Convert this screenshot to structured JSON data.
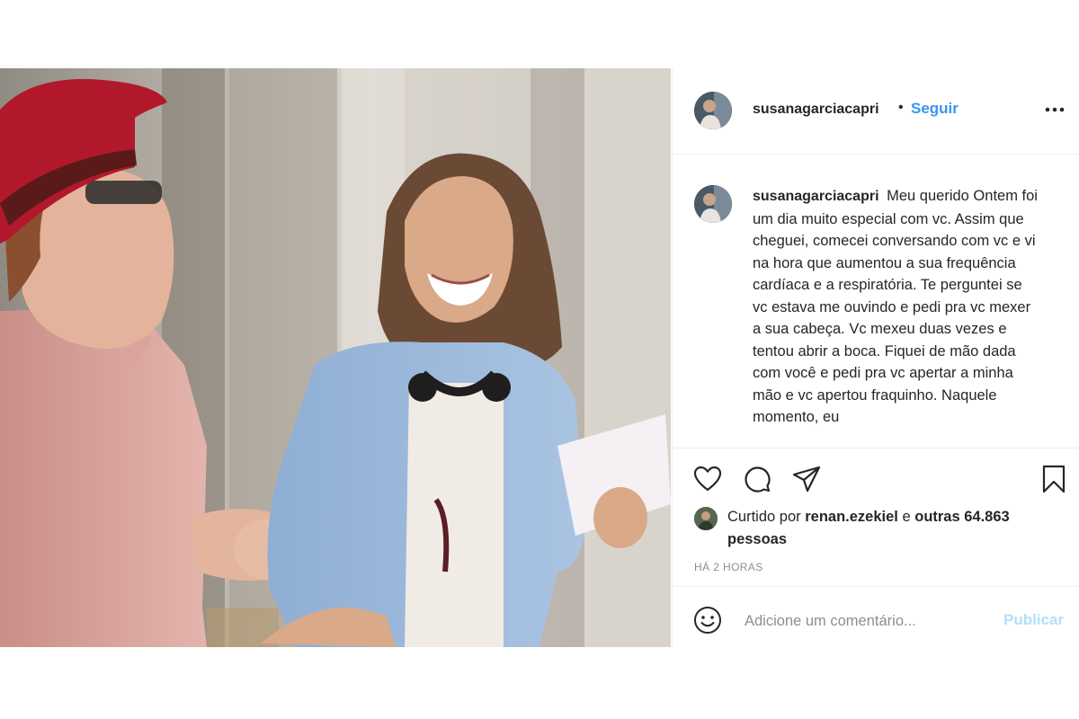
{
  "post": {
    "photo_alt": "",
    "author": {
      "username": "susanagarciacapri",
      "follow_label": "Seguir",
      "separator": "•"
    },
    "caption": {
      "username": "susanagarciacapri",
      "text": "Meu querido Ontem foi um dia muito especial com vc. Assim que cheguei, comecei conversando com vc e vi na hora que aumentou a sua frequência cardíaca e a respiratória. Te perguntei se vc estava me ouvindo e pedi pra vc mexer a sua cabeça. Vc mexeu duas vezes e tentou abrir a boca. Fiquei de mão dada com você e pedi pra vc apertar a minha mão e vc apertou fraquinho. Naquele momento, eu"
    },
    "likes": {
      "prefix": "Curtido por",
      "liker": "renan.ezekiel",
      "conjunction": "e",
      "others": "outras 64.863 pessoas"
    },
    "timestamp": "HÁ 2 HORAS",
    "comment": {
      "placeholder": "Adicione um comentário...",
      "value": "",
      "publish_label": "Publicar"
    }
  },
  "icons": {
    "more": "more-horizontal-icon",
    "like": "heart-icon",
    "comment": "comment-bubble-icon",
    "share": "paper-plane-icon",
    "save": "bookmark-icon",
    "emoji": "smiley-icon"
  },
  "colors": {
    "follow": "#3897f0",
    "publish_disabled": "#b2dffc",
    "text": "#262626",
    "muted": "#8e8e8e",
    "divider": "#efefef"
  }
}
